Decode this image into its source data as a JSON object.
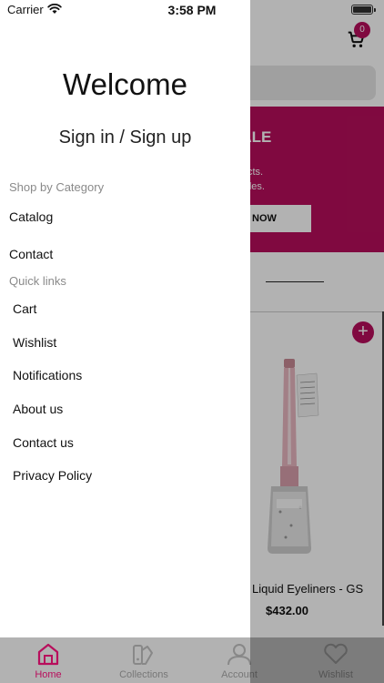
{
  "status_bar": {
    "carrier": "Carrier",
    "time": "3:58 PM"
  },
  "drawer": {
    "welcome": "Welcome",
    "sign_in": "Sign in / Sign up",
    "shop_by_category": {
      "heading": "Shop by Category",
      "items": [
        "Catalog",
        "Contact"
      ]
    },
    "quick_links": {
      "heading": "Quick links",
      "items": [
        "Cart",
        "Wishlist",
        "Notifications",
        "About us",
        "Contact us",
        "Privacy Policy"
      ]
    }
  },
  "background": {
    "cart_count": "0",
    "banner": {
      "title": "IER SALE",
      "line1": "auty products.",
      "line2": "ongoing sales.",
      "button": "NOW"
    },
    "product": {
      "name": "Liquid Eyeliners - GS",
      "price": "$432.00"
    }
  },
  "tabbar": {
    "tabs": [
      {
        "label": "Home",
        "icon": "home-icon",
        "active": true
      },
      {
        "label": "Collections",
        "icon": "collections-icon",
        "active": false
      },
      {
        "label": "Account",
        "icon": "account-icon",
        "active": false
      },
      {
        "label": "Wishlist",
        "icon": "heart-icon",
        "active": false
      }
    ]
  },
  "colors": {
    "accent": "#b80e5c",
    "dim_overlay": "rgba(0,0,0,0.30)"
  }
}
